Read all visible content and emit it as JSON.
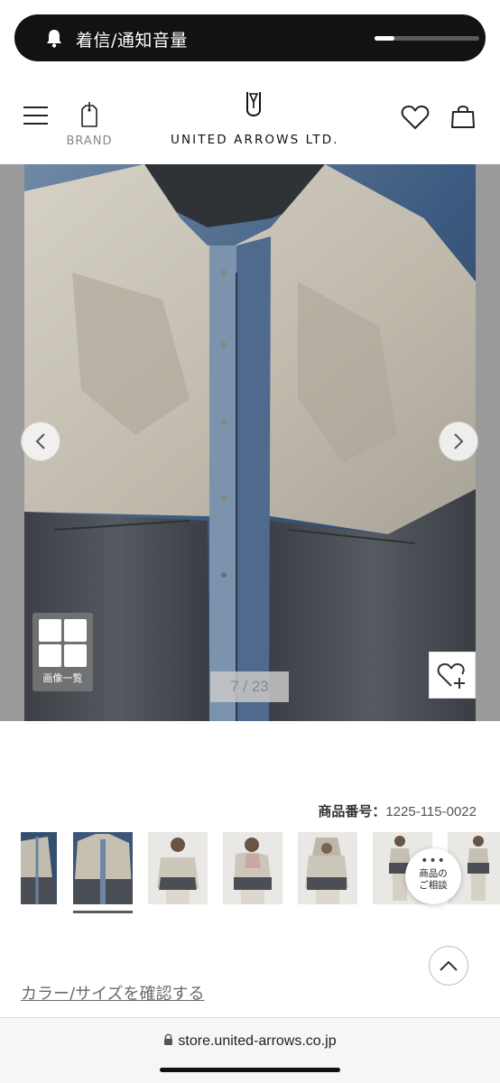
{
  "notification": {
    "label": "着信/通知音量",
    "volume_fraction": 0.19,
    "icon": "bell-icon"
  },
  "header": {
    "brand_label": "BRAND",
    "logo_text": "UNITED ARROWS LTD.",
    "icons": [
      "hamburger-menu-icon",
      "brand-bag-icon",
      "heart-icon",
      "cart-icon"
    ]
  },
  "gallery": {
    "counter": "7 / 23",
    "image_list_label": "画像一覧",
    "arrows": [
      "chevron-left-icon",
      "chevron-right-icon"
    ],
    "add_favorite_icon": "heart-plus-icon"
  },
  "product": {
    "number_label": "商品番号：",
    "number_value": "1225-115-0022"
  },
  "thumbnails": {
    "count_visible": 7,
    "active_index": 1
  },
  "consult": {
    "dots": "•••",
    "line1": "商品の",
    "line2": "ご相談"
  },
  "color_size_link": "カラー/サイズを確認する",
  "url_bar": {
    "url": "store.united-arrows.co.jp"
  },
  "colors": {
    "jacket_beige": "#c9c3b6",
    "jacket_dark": "#4d5157",
    "background_blue": "#3d5a80"
  }
}
